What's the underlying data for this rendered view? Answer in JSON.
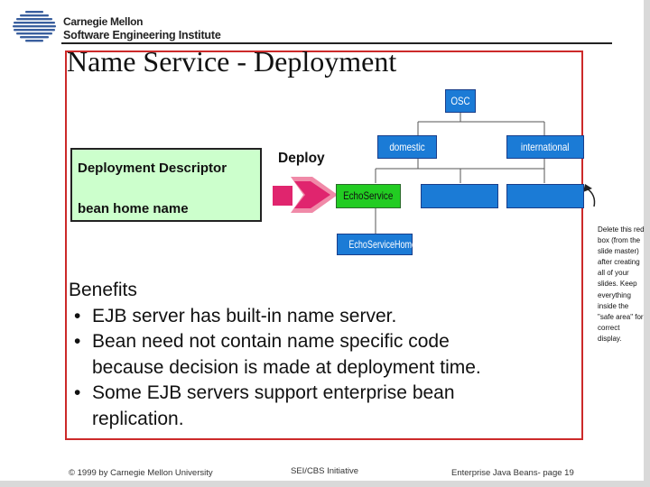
{
  "header": {
    "org_line1": "Carnegie Mellon",
    "org_line2": "Software Engineering Institute"
  },
  "slide": {
    "title": "Name Service - Deployment",
    "descriptor": {
      "title": "Deployment Descriptor",
      "field": "bean home name"
    },
    "deploy_label": "Deploy",
    "tree": {
      "root": "OSC",
      "level1": [
        "domestic",
        "international"
      ],
      "selected": "EchoService",
      "home": "EchoServiceHome"
    },
    "benefits": {
      "heading": "Benefits",
      "items": [
        {
          "text": "EJB server has built-in name server.",
          "cont": ""
        },
        {
          "text": "Bean need not contain name specific code",
          "cont": "because decision is made at deployment time."
        },
        {
          "text": "Some EJB servers support enterprise bean",
          "cont": "replication."
        }
      ]
    },
    "master_note": "Delete this red box (from the slide master) after creating all of your slides. Keep everything inside the \"safe area\" for correct display."
  },
  "footer": {
    "copyright": "© 1999 by Carnegie Mellon University",
    "initiative": "SEI/CBS Initiative",
    "page": "Enterprise Java Beans- page 19"
  },
  "colors": {
    "node_blue": "#1b7bd6",
    "selected_green": "#22cc22",
    "safe_box_red": "#cc2a2a",
    "descriptor_bg": "#ccffcc",
    "arrow_magenta": "#e0256e"
  }
}
